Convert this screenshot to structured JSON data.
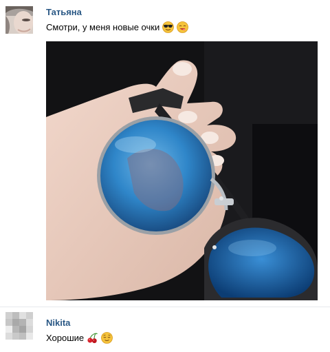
{
  "messages": [
    {
      "author": "Татьяна",
      "text": "Смотри, у меня новые очки",
      "emojis": [
        "sunglasses-emoji",
        "smiling-emoji"
      ],
      "attachment": "photo-sunglasses-in-hand"
    },
    {
      "author": "Nikita",
      "text": "Хорошие",
      "emojis": [
        "cherries-emoji",
        "relieved-emoji"
      ]
    }
  ],
  "colors": {
    "author_link": "#2a5885",
    "text": "#000000",
    "background": "#ffffff",
    "divider": "#e7e8ec"
  }
}
